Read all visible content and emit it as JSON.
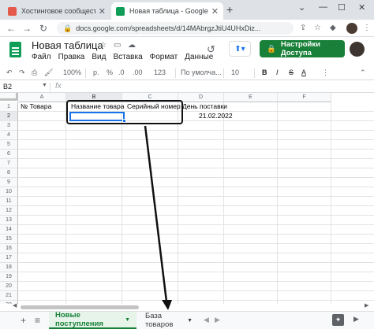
{
  "browser": {
    "tabs": [
      {
        "label": "Хостинговое сообщество «Time",
        "close": "✕",
        "favicon_color": "#e5594a"
      },
      {
        "label": "Новая таблица - Google Табли",
        "close": "✕",
        "favicon_color": "#0f9d58"
      }
    ],
    "new_tab": "+",
    "window_controls": [
      "⌄",
      "—",
      "☐",
      "✕"
    ],
    "url": "docs.google.com/spreadsheets/d/14MAbrgzJtiU4UHxDiz..."
  },
  "sheets": {
    "title": "Новая таблица",
    "menu": [
      "Файл",
      "Правка",
      "Вид",
      "Вставка",
      "Формат",
      "Данные"
    ],
    "share_label": "Настройки Доступа",
    "toolbar": {
      "zoom": "100%",
      "currency": "р.",
      "percent": "%",
      "dec_less": ".0",
      "dec_more": ".00",
      "num_format": "123",
      "font": "По умолча...",
      "font_size": "10"
    },
    "cell_ref": "B2",
    "fx": "fx",
    "columns": [
      "A",
      "B",
      "C",
      "D",
      "E",
      "F"
    ],
    "rows": [
      "1",
      "2",
      "3",
      "4",
      "5",
      "6",
      "7",
      "8",
      "9",
      "10",
      "11",
      "12",
      "13",
      "14",
      "15",
      "16",
      "17",
      "18",
      "19",
      "20",
      "21",
      "22"
    ],
    "cells": {
      "A1": "№ Товара",
      "B1": "Название товара",
      "C1": "Серийный номер",
      "D1": "День поставки",
      "D2": "21.02.2022"
    },
    "sheet_tabs": [
      {
        "label": "Новые поступления",
        "active": true
      },
      {
        "label": "База товаров",
        "active": false
      }
    ],
    "add_sheet": "+",
    "all_sheets": "≡"
  },
  "colors": {
    "accent_green": "#188038",
    "selection_blue": "#1a73e8",
    "annotation": "#111111"
  }
}
